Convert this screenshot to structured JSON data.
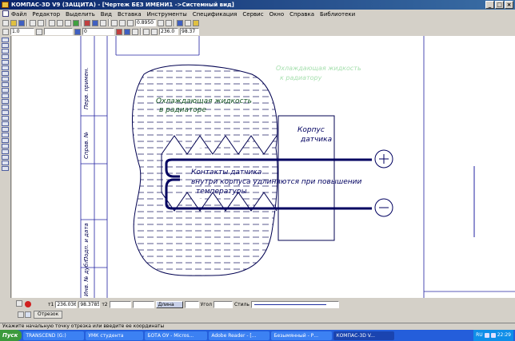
{
  "window": {
    "title": "КОМПАС-3D V9 (ЗАЩИТА) - [Чертеж БЕЗ ИМЕНИ1 ->Системный вид]",
    "controls": [
      "_",
      "□",
      "×"
    ]
  },
  "menu": [
    "Файл",
    "Редактор",
    "Выделить",
    "Вид",
    "Вставка",
    "Инструменты",
    "Спецификация",
    "Сервис",
    "Окно",
    "Справка",
    "Библиотеки"
  ],
  "toolbar": {
    "zoom": "0.8950",
    "coord_x": "236.0",
    "coord_y": "98.37",
    "step": "1.0",
    "layer": "0"
  },
  "drawing": {
    "stamp": [
      "Перв. примен.",
      "Справ. №",
      "Подп. и дата",
      "Инв. № дубл."
    ],
    "faded_note_1": "Охлаждающая жидкость",
    "faded_note_2": "к радиатору",
    "liquid_line_1": "Охлаждающая жидкость",
    "liquid_line_2": "в радиаторе",
    "body_line_1": "Корпус",
    "body_line_2": "датчика",
    "contacts_line_1": "Контакты датчика",
    "contacts_line_2": "внутри корпуса удлиняются при повышении",
    "contacts_line_3": "температуры"
  },
  "properties": {
    "t1_label": "т1",
    "t1_x": "236.0365",
    "t1_y": "98.3785",
    "t2_label": "т2",
    "length_label": "Длина",
    "angle_label": "Угол",
    "style_label": "Стиль",
    "tab": "Отрезок"
  },
  "status": "Укажите начальную точку отрезка или введите ее координаты",
  "taskbar": {
    "start": "Пуск",
    "tasks": [
      "TRANSCEND (G:)",
      "УМК студента",
      "БОТА ОУ - Micros...",
      "Adobe Reader - [...",
      "Безымянный - Р...",
      "КОМПАС-3D V..."
    ],
    "lang": "RU",
    "clock": "22:29"
  }
}
